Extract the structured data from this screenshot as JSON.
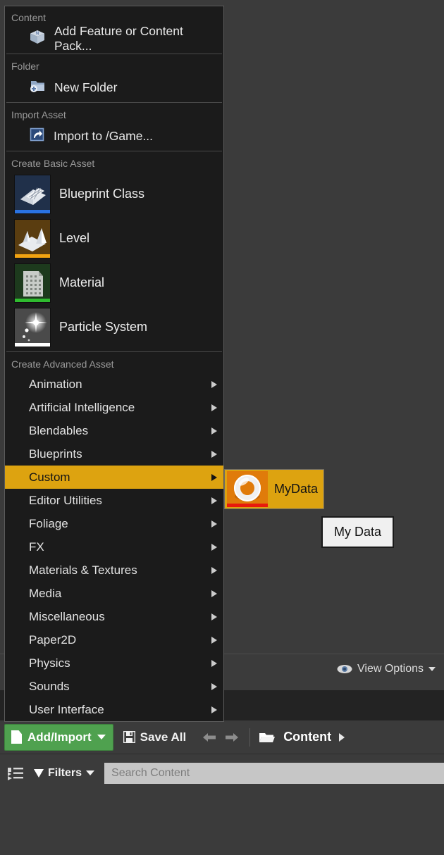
{
  "theme": {
    "menu_bg": "#1b1b1b",
    "menu_border": "#5b5b5b",
    "panel_bg": "#3b3b3b",
    "highlight": "#dda310",
    "accent_green": "#4fa14f",
    "search_bg": "#c6c6c6"
  },
  "context_menu": {
    "sections": [
      {
        "heading": "Content",
        "items": [
          {
            "label": "Add Feature or Content Pack...",
            "icon": "content-pack-box-icon"
          }
        ]
      },
      {
        "heading": "Folder",
        "items": [
          {
            "label": "New Folder",
            "icon": "new-folder-icon"
          }
        ]
      },
      {
        "heading": "Import Asset",
        "items": [
          {
            "label": "Import to /Game...",
            "icon": "import-arrow-icon"
          }
        ]
      }
    ],
    "basic_asset": {
      "heading": "Create Basic Asset",
      "items": [
        {
          "label": "Blueprint Class",
          "icon": "blueprint-class-icon",
          "accent": "#2a72e0",
          "thumb_bg": "#20304a"
        },
        {
          "label": "Level",
          "icon": "level-icon",
          "accent": "#f2a311",
          "thumb_bg": "#5a3d10"
        },
        {
          "label": "Material",
          "icon": "material-icon",
          "accent": "#2fbb2f",
          "thumb_bg": "#1d3a1d"
        },
        {
          "label": "Particle System",
          "icon": "particle-system-icon",
          "accent": "#ffffff",
          "thumb_bg": "#4a4a4a"
        }
      ]
    },
    "advanced_asset": {
      "heading": "Create Advanced Asset",
      "items": [
        {
          "label": "Animation",
          "has_submenu": true,
          "highlighted": false
        },
        {
          "label": "Artificial Intelligence",
          "has_submenu": true,
          "highlighted": false
        },
        {
          "label": "Blendables",
          "has_submenu": true,
          "highlighted": false
        },
        {
          "label": "Blueprints",
          "has_submenu": true,
          "highlighted": false
        },
        {
          "label": "Custom",
          "has_submenu": true,
          "highlighted": true
        },
        {
          "label": "Editor Utilities",
          "has_submenu": true,
          "highlighted": false
        },
        {
          "label": "Foliage",
          "has_submenu": true,
          "highlighted": false
        },
        {
          "label": "FX",
          "has_submenu": true,
          "highlighted": false
        },
        {
          "label": "Materials & Textures",
          "has_submenu": true,
          "highlighted": false
        },
        {
          "label": "Media",
          "has_submenu": true,
          "highlighted": false
        },
        {
          "label": "Miscellaneous",
          "has_submenu": true,
          "highlighted": false
        },
        {
          "label": "Paper2D",
          "has_submenu": true,
          "highlighted": false
        },
        {
          "label": "Physics",
          "has_submenu": true,
          "highlighted": false
        },
        {
          "label": "Sounds",
          "has_submenu": true,
          "highlighted": false
        },
        {
          "label": "User Interface",
          "has_submenu": true,
          "highlighted": false
        }
      ]
    }
  },
  "submenu": {
    "item_label": "MyData",
    "item_icon": "mydata-torus-icon"
  },
  "tooltip": {
    "text": "My Data"
  },
  "view_options": {
    "label": "View Options",
    "icon": "eye-icon"
  },
  "toolbar": {
    "add_import_label": "Add/Import",
    "save_all_label": "Save All",
    "breadcrumb_label": "Content",
    "back_icon": "arrow-left-icon",
    "forward_icon": "arrow-right-icon",
    "folder_icon": "folder-open-icon"
  },
  "filter_bar": {
    "filters_label": "Filters",
    "search_placeholder": "Search Content",
    "search_value": "",
    "tree_icon": "tree-view-icon"
  }
}
